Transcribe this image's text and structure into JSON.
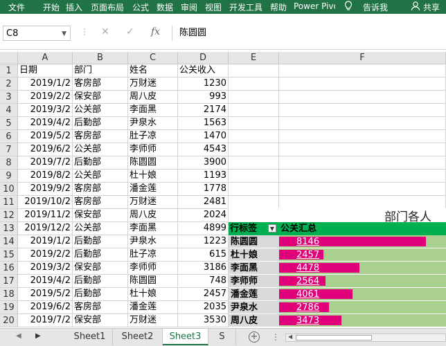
{
  "ribbon": {
    "tabs": [
      "文件",
      "开始",
      "插入",
      "页面布局",
      "公式",
      "数据",
      "审阅",
      "视图",
      "开发工具",
      "帮助",
      "Power Pivot"
    ],
    "tell_me": "告诉我",
    "share": "共享"
  },
  "formula_bar": {
    "name_box": "C8",
    "content": "陈圆圆"
  },
  "grid": {
    "columns": [
      "A",
      "B",
      "C",
      "D",
      "E",
      "F"
    ],
    "rows": [
      {
        "n": "1",
        "a": "日期",
        "b": "部门",
        "c": "姓名",
        "d": "公关收入"
      },
      {
        "n": "2",
        "a": "2019/1/2",
        "b": "客房部",
        "c": "万财迷",
        "d": "1230"
      },
      {
        "n": "3",
        "a": "2019/2/2",
        "b": "保安部",
        "c": "周八皮",
        "d": "993"
      },
      {
        "n": "4",
        "a": "2019/3/2",
        "b": "公关部",
        "c": "李面黑",
        "d": "2174"
      },
      {
        "n": "5",
        "a": "2019/4/2",
        "b": "后勤部",
        "c": "尹泉水",
        "d": "1563"
      },
      {
        "n": "6",
        "a": "2019/5/2",
        "b": "客房部",
        "c": "肚子凉",
        "d": "1470"
      },
      {
        "n": "7",
        "a": "2019/6/2",
        "b": "公关部",
        "c": "李师师",
        "d": "4543"
      },
      {
        "n": "8",
        "a": "2019/7/2",
        "b": "后勤部",
        "c": "陈圆圆",
        "d": "3900"
      },
      {
        "n": "9",
        "a": "2019/8/2",
        "b": "公关部",
        "c": "杜十娘",
        "d": "1193"
      },
      {
        "n": "10",
        "a": "2019/9/2",
        "b": "客房部",
        "c": "潘金莲",
        "d": "1778"
      },
      {
        "n": "11",
        "a": "2019/10/2",
        "b": "客房部",
        "c": "万财迷",
        "d": "2481"
      },
      {
        "n": "12",
        "a": "2019/11/2",
        "b": "保安部",
        "c": "周八皮",
        "d": "2024"
      },
      {
        "n": "13",
        "a": "2019/12/2",
        "b": "公关部",
        "c": "李面黑",
        "d": "4899"
      },
      {
        "n": "14",
        "a": "2019/1/2",
        "b": "后勤部",
        "c": "尹泉水",
        "d": "1223"
      },
      {
        "n": "15",
        "a": "2019/2/2",
        "b": "后勤部",
        "c": "肚子凉",
        "d": "615"
      },
      {
        "n": "16",
        "a": "2019/3/2",
        "b": "保安部",
        "c": "李师师",
        "d": "3186"
      },
      {
        "n": "17",
        "a": "2019/4/2",
        "b": "后勤部",
        "c": "陈圆圆",
        "d": "748"
      },
      {
        "n": "18",
        "a": "2019/5/2",
        "b": "后勤部",
        "c": "杜十娘",
        "d": "2457"
      },
      {
        "n": "19",
        "a": "2019/6/2",
        "b": "客房部",
        "c": "潘金莲",
        "d": "2035"
      },
      {
        "n": "20",
        "a": "2019/7/2",
        "b": "保安部",
        "c": "万财迷",
        "d": "3530"
      }
    ]
  },
  "chart_title": "部门各人",
  "pivot": {
    "header_label": "行标签",
    "header_value": "公关汇总",
    "max": 9000,
    "rows": [
      {
        "name": "陈圆圆",
        "value": 8146
      },
      {
        "name": "杜十娘",
        "value": 2457
      },
      {
        "name": "李面黑",
        "value": 4478
      },
      {
        "name": "李师师",
        "value": 2564
      },
      {
        "name": "潘金莲",
        "value": 4061
      },
      {
        "name": "尹泉水",
        "value": 2786
      },
      {
        "name": "周八皮",
        "value": 3473
      }
    ]
  },
  "sheets": {
    "tabs": [
      "Sheet1",
      "Sheet2",
      "Sheet3",
      "S"
    ],
    "active": 2
  },
  "colors": {
    "ribbon": "#217346",
    "pivot_header": "#00b050",
    "bar": "#e0007a",
    "track": "#a9d08e"
  }
}
